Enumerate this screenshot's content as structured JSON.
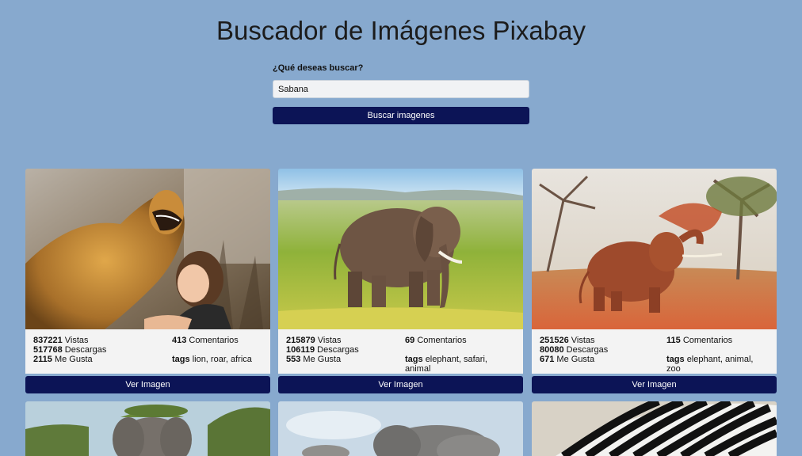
{
  "header": {
    "title": "Buscador de Imágenes Pixabay"
  },
  "search": {
    "label": "¿Qué deseas buscar?",
    "value": "Sabana",
    "button_label": "Buscar imagenes"
  },
  "cards": [
    {
      "image": "lion-and-girl",
      "views": "837221",
      "views_label": "Vistas",
      "downloads": "517768",
      "downloads_label": "Descargas",
      "likes": "2115",
      "likes_label": "Me Gusta",
      "comments": "413",
      "comments_label": "Comentarios",
      "tags_label": "tags",
      "tags": "lion, roar, africa",
      "button_label": "Ver Imagen"
    },
    {
      "image": "elephant-grassland",
      "views": "215879",
      "views_label": "Vistas",
      "downloads": "106119",
      "downloads_label": "Descargas",
      "likes": "553",
      "likes_label": "Me Gusta",
      "comments": "69",
      "comments_label": "Comentarios",
      "tags_label": "tags",
      "tags": "elephant, safari, animal",
      "button_label": "Ver Imagen"
    },
    {
      "image": "elephant-red-dust",
      "views": "251526",
      "views_label": "Vistas",
      "downloads": "80080",
      "downloads_label": "Descargas",
      "likes": "671",
      "likes_label": "Me Gusta",
      "comments": "115",
      "comments_label": "Comentarios",
      "tags_label": "tags",
      "tags": "elephant, animal, zoo",
      "button_label": "Ver Imagen"
    },
    {
      "image": "elephant-bush"
    },
    {
      "image": "elephants-lying"
    },
    {
      "image": "zebra"
    }
  ]
}
